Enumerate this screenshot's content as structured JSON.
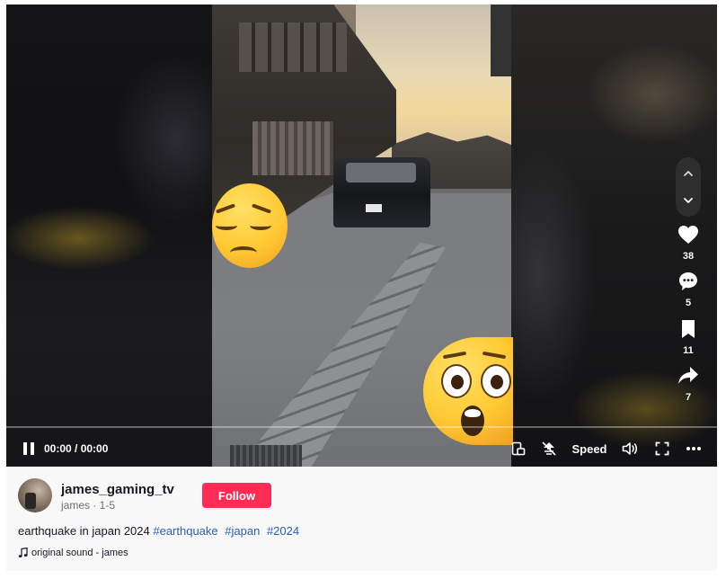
{
  "player": {
    "time_display": "00:00 / 00:00",
    "progress": 0,
    "speed_label": "Speed"
  },
  "actions": {
    "likes": "38",
    "comments": "5",
    "saves": "11",
    "shares": "7"
  },
  "author": {
    "username": "james_gaming_tv",
    "subline": "james · 1-5",
    "follow_label": "Follow"
  },
  "caption": {
    "text": "earthquake in japan 2024 ",
    "hashtags": [
      "#earthquake",
      "#japan",
      "#2024"
    ]
  },
  "sound": {
    "icon": "music-note-icon",
    "label": "original sound - james"
  },
  "colors": {
    "follow": "#fe2c55",
    "hashtag": "#2b5db9"
  }
}
